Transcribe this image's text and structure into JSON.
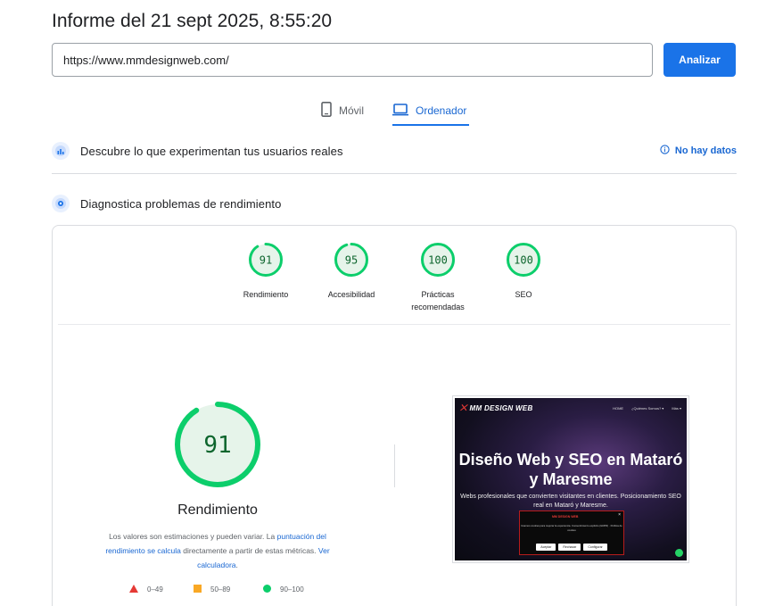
{
  "header": {
    "title": "Informe del 21 sept 2025, 8:55:20"
  },
  "search": {
    "url_value": "https://www.mmdesignweb.com/",
    "analyze_label": "Analizar"
  },
  "device_tabs": [
    {
      "label": "Móvil",
      "icon": "smartphone-icon",
      "selected": false
    },
    {
      "label": "Ordenador",
      "icon": "laptop-icon",
      "selected": true
    }
  ],
  "field_data": {
    "label": "Descubre lo que experimentan tus usuarios reales",
    "status": "No hay datos"
  },
  "lab_data": {
    "label": "Diagnostica problemas de rendimiento"
  },
  "categories": [
    {
      "name": "Rendimiento",
      "score": "91"
    },
    {
      "name": "Accesibilidad",
      "score": "95"
    },
    {
      "name": "Prácticas recomendadas",
      "score": "100"
    },
    {
      "name": "SEO",
      "score": "100"
    }
  ],
  "category_scores": [
    91,
    95,
    100,
    100
  ],
  "performance": {
    "score": "91",
    "score_value": 91,
    "title": "Rendimiento",
    "desc_pre": "Los valores son estimaciones y pueden variar. La ",
    "desc_link1": "puntuación del rendimiento se calcula",
    "desc_mid": " directamente a partir de estas métricas. ",
    "desc_link2": "Ver calculadora",
    "desc_post": "."
  },
  "legend": [
    {
      "range": "0–49",
      "shape": "triangle",
      "color": "#e53935"
    },
    {
      "range": "50–89",
      "shape": "square",
      "color": "#f9a825"
    },
    {
      "range": "90–100",
      "shape": "circle",
      "color": "#0cce6b"
    }
  ],
  "colors": {
    "accent": "#1a73e8",
    "pass": "#0cce6b",
    "pass_text": "#0d652d",
    "pass_bg": "#e6f4ea"
  },
  "site_preview": {
    "logo_text": "MM DESIGN WEB",
    "nav_items": [
      "HOME",
      "¿Quiénes Somos? ▾",
      "Más ▾"
    ],
    "headline": "Diseño Web y SEO en Mataró y Maresme",
    "subline": "Webs profesionales que convierten visitantes en clientes. Posicionamiento SEO real en Mataró y Maresme.",
    "cookie_logo": "MM DESIGN WEB",
    "cookie_text": "Usamos cookies para mejorar la experiencia. Consentimiento explícito (GDPR) · Política de cookies",
    "cookie_buttons": [
      "Aceptar",
      "Rechazar",
      "Configurar"
    ]
  }
}
